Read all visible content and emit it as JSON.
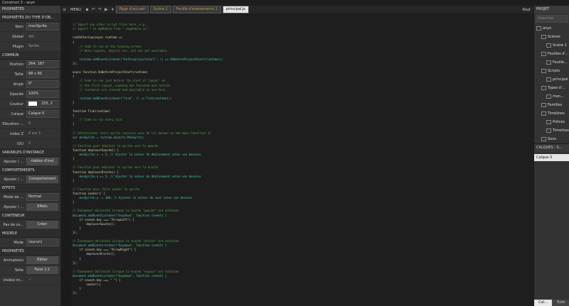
{
  "window_title": "Construct 3 - anyn",
  "left_panel": {
    "tab": "PROPRIÉTÉS",
    "section_header": "PROPRIÉTÉS DU TYPE D'OB...",
    "rows": [
      {
        "label": "Nom",
        "value": "monSprite",
        "kind": "input"
      },
      {
        "label": "Global",
        "value": "",
        "kind": "toggle"
      },
      {
        "label": "Plugin",
        "value": "Sprite",
        "kind": "flat"
      }
    ],
    "common_header": "COMMUN",
    "common_rows": [
      {
        "label": "Position",
        "value": "264, 187",
        "kind": "input"
      },
      {
        "label": "Taille",
        "value": "68 x 90",
        "kind": "input"
      },
      {
        "label": "Angle",
        "value": "0°",
        "kind": "input"
      },
      {
        "label": "Opacité",
        "value": "100%",
        "kind": "input"
      },
      {
        "label": "Couleur",
        "value": "255, 2",
        "kind": "color"
      },
      {
        "label": "Calque",
        "value": "Calque 0",
        "kind": "input"
      },
      {
        "label": "Élévation ...",
        "value": "0",
        "kind": "flat"
      },
      {
        "label": "Index Z",
        "value": "0 sur 1",
        "kind": "flat"
      },
      {
        "label": "IDU",
        "value": "2",
        "kind": "flat"
      }
    ],
    "var_header": "VARIABLES D'INSTANCE",
    "var_row": {
      "label": "Ajouter / ...",
      "value": "riables d'inst"
    },
    "comp_header": "COMPORTEMENTS",
    "comp_row": {
      "label": "Ajouter / ...",
      "value": "Comportement"
    },
    "effects_header": "EFFETS",
    "effects_rows": [
      {
        "label": "Mode de ...",
        "value": "Normal"
      },
      {
        "label": "Ajouter / ...",
        "value": "Effets"
      }
    ],
    "container_header": "CONTENEUR",
    "container_row": {
      "label": "Pas de co...",
      "value": "Créer"
    },
    "model_header": "MODÈLE",
    "model_row": {
      "label": "Mode",
      "value": "(aucun)"
    },
    "props_header": "PROPRIÉTÉS",
    "props_rows": [
      {
        "label": "Animations",
        "value": "Éditer"
      },
      {
        "label": "Taille",
        "value": "Faire 1:1"
      },
      {
        "label": "Visible ini...",
        "value": "✓"
      }
    ]
  },
  "toolbar": {
    "menu_label": "MENU",
    "tabs": [
      {
        "label": "Page d'accueil",
        "active": false
      },
      {
        "label": "Scène 1",
        "active": false
      },
      {
        "label": "Feuille d'événements 1",
        "active": false
      },
      {
        "label": "principal.js",
        "active": true
      }
    ],
    "right_label": "Rayt"
  },
  "code_lines": [
    {
      "t": "",
      "c": "pl"
    },
    {
      "t": "// Import any other script files here, e.g.:",
      "c": "cm"
    },
    {
      "t": "// import * as myModule from \"./mymodule.js\";",
      "c": "cm"
    },
    {
      "t": "",
      "c": "pl"
    },
    {
      "t": "runOnStartup(async runtime =>",
      "c": "kw"
    },
    {
      "t": "{",
      "c": "pl"
    },
    {
      "t": "    // Code to run on the loading screen.",
      "c": "cm"
    },
    {
      "t": "    // Note layouts, objects etc. are not yet available.",
      "c": "cm"
    },
    {
      "t": "",
      "c": "pl"
    },
    {
      "t": "    runtime.addEventListener(\"beforeprojectstart\", () => OnBeforeProjectStart(runtime));",
      "c": "fn"
    },
    {
      "t": "});",
      "c": "pl"
    },
    {
      "t": "",
      "c": "pl"
    },
    {
      "t": "async function OnBeforeProjectStart(runtime)",
      "c": "kw"
    },
    {
      "t": "{",
      "c": "pl"
    },
    {
      "t": "    // Code to run just before 'On start of layout' on",
      "c": "cm"
    },
    {
      "t": "    // the first layout. Loading has finished and initial",
      "c": "cm"
    },
    {
      "t": "    // instances are created and available to use here.",
      "c": "cm"
    },
    {
      "t": "",
      "c": "pl"
    },
    {
      "t": "    runtime.addEventListener(\"tick\", () => Tick(runtime));",
      "c": "fn"
    },
    {
      "t": "}",
      "c": "pl"
    },
    {
      "t": "",
      "c": "pl"
    },
    {
      "t": "function Tick(runtime)",
      "c": "kw"
    },
    {
      "t": "{",
      "c": "pl"
    },
    {
      "t": "    // Code to run every tick",
      "c": "cm"
    },
    {
      "t": "}",
      "c": "pl"
    },
    {
      "t": "",
      "c": "pl"
    },
    {
      "t": "// Sélectionner votre sprite (assurez-vous de lui donner un nom dans Construct 3)",
      "c": "cm"
    },
    {
      "t": "var monSprite = runtime.objects.MonSprite;",
      "c": "fn"
    },
    {
      "t": "",
      "c": "pl"
    },
    {
      "t": "// Fonction pour déplacer le sprite vers la gauche",
      "c": "cm"
    },
    {
      "t": "function deplacerGauche() {",
      "c": "kw"
    },
    {
      "t": "    monSprite.x -= 5; // Ajuster la valeur de déplacement selon vos besoins",
      "c": "fn"
    },
    {
      "t": "}",
      "c": "pl"
    },
    {
      "t": "",
      "c": "pl"
    },
    {
      "t": "// Fonction pour déplacer le sprite vers la droite",
      "c": "cm"
    },
    {
      "t": "function deplacerDroite() {",
      "c": "kw"
    },
    {
      "t": "    monSprite.x += 5; // Ajuster la valeur de déplacement selon vos besoins",
      "c": "fn"
    },
    {
      "t": "}",
      "c": "pl"
    },
    {
      "t": "",
      "c": "pl"
    },
    {
      "t": "// Fonction pour faire sauter le sprite",
      "c": "cm"
    },
    {
      "t": "function sauter() {",
      "c": "kw"
    },
    {
      "t": "    monSprite.y -= 100; // Ajuster la valeur de saut selon vos besoins",
      "c": "fn"
    },
    {
      "t": "}",
      "c": "pl"
    },
    {
      "t": "",
      "c": "pl"
    },
    {
      "t": "// Événement déclenché lorsque la touche \"gauche\" est enfoncée",
      "c": "cm"
    },
    {
      "t": "document.addEventListener(\"keydown\", function (event) {",
      "c": "fn"
    },
    {
      "t": "    if (event.key === \"ArrowLeft\") {",
      "c": "kw"
    },
    {
      "t": "        deplacerGauche();",
      "c": "pl"
    },
    {
      "t": "    }",
      "c": "pl"
    },
    {
      "t": "});",
      "c": "pl"
    },
    {
      "t": "",
      "c": "pl"
    },
    {
      "t": "// Événement déclenché lorsque la touche \"droite\" est enfoncée",
      "c": "cm"
    },
    {
      "t": "document.addEventListener(\"keydown\", function (event) {",
      "c": "fn"
    },
    {
      "t": "    if (event.key === \"ArrowRight\") {",
      "c": "kw"
    },
    {
      "t": "        deplacerDroite();",
      "c": "pl"
    },
    {
      "t": "    }",
      "c": "pl"
    },
    {
      "t": "});",
      "c": "pl"
    },
    {
      "t": "",
      "c": "pl"
    },
    {
      "t": "// Événement déclenché lorsque la touche \"espace\" est enfoncée",
      "c": "cm"
    },
    {
      "t": "document.addEventListener(\"keydown\", function (event) {",
      "c": "fn"
    },
    {
      "t": "    if (event.key === \" \") {",
      "c": "kw"
    },
    {
      "t": "        sauter();",
      "c": "pl"
    },
    {
      "t": "    }",
      "c": "pl"
    },
    {
      "t": "});",
      "c": "pl"
    }
  ],
  "right_panel": {
    "tab": "PROJET",
    "search_placeholder": "Chercher",
    "tree": [
      {
        "label": "anyn",
        "indent": 0
      },
      {
        "label": "Scènes",
        "indent": 1
      },
      {
        "label": "Scène 1",
        "indent": 2
      },
      {
        "label": "Feuilles d'...",
        "indent": 1
      },
      {
        "label": "Feuille...",
        "indent": 2
      },
      {
        "label": "Scripts",
        "indent": 1
      },
      {
        "label": "principal",
        "indent": 2
      },
      {
        "label": "Types d'...",
        "indent": 1
      },
      {
        "label": "mon...",
        "indent": 2
      },
      {
        "label": "Familles",
        "indent": 1
      },
      {
        "label": "Timelines",
        "indent": 1
      },
      {
        "label": "Polices",
        "indent": 2
      },
      {
        "label": "Timelines",
        "indent": 2
      },
      {
        "label": "Sons",
        "indent": 1
      }
    ],
    "layers_header": "CALQUES - S...",
    "layer_item": "Calque 0",
    "bottom_tabs": [
      {
        "label": "Cal...",
        "on": true
      },
      {
        "label": "Tuile",
        "on": false
      }
    ]
  }
}
